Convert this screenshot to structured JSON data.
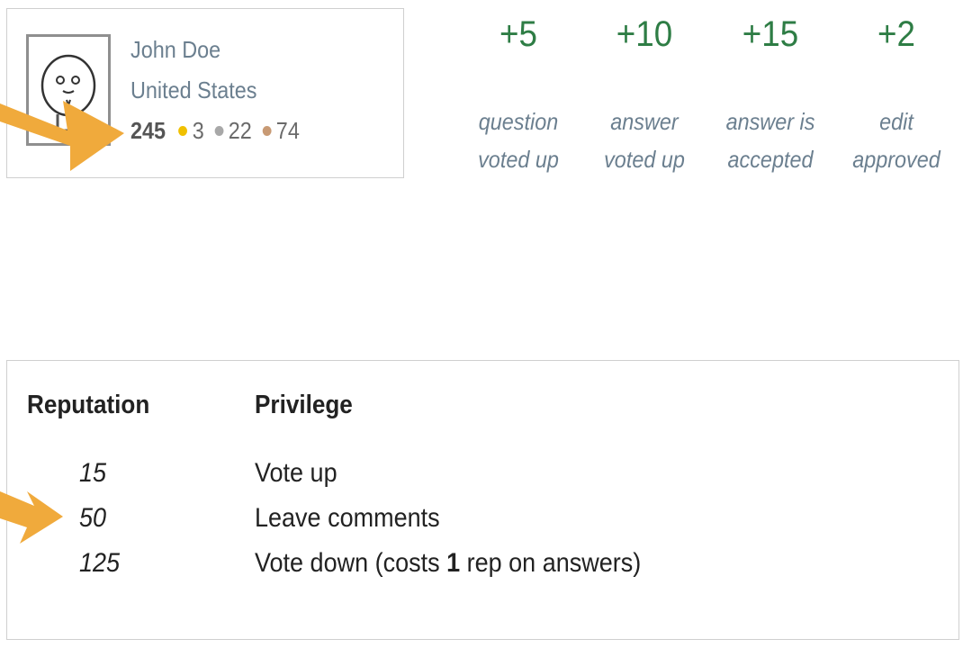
{
  "user": {
    "name": "John Doe",
    "location": "United States",
    "reputation": "245",
    "badges": [
      {
        "type": "gold",
        "count": "3",
        "color": "#f0c000"
      },
      {
        "type": "silver",
        "count": "22",
        "color": "#a8a8a8"
      },
      {
        "type": "bronze",
        "count": "74",
        "color": "#c89a74"
      }
    ]
  },
  "gains": [
    {
      "points": "+5",
      "line1": "question",
      "line2": "voted up"
    },
    {
      "points": "+10",
      "line1": "answer",
      "line2": "voted up"
    },
    {
      "points": "+15",
      "line1": "answer is",
      "line2": "accepted"
    },
    {
      "points": "+2",
      "line1": "edit",
      "line2": "approved"
    }
  ],
  "privileges": {
    "header_reputation": "Reputation",
    "header_privilege": "Privilege",
    "rows": [
      {
        "rep": "15",
        "privilege": "Vote up"
      },
      {
        "rep": "50",
        "privilege": "Leave comments"
      },
      {
        "rep": "125",
        "privilege_pre": "Vote down (costs ",
        "privilege_bold": "1",
        "privilege_post": " rep on answers)"
      }
    ]
  },
  "colors": {
    "gain_green": "#2e7d45",
    "arrow_orange": "#f0aa3c",
    "meta_blue_gray": "#6b7f8f"
  },
  "icons": [
    "default-avatar-icon",
    "pointer-arrow-icon"
  ]
}
